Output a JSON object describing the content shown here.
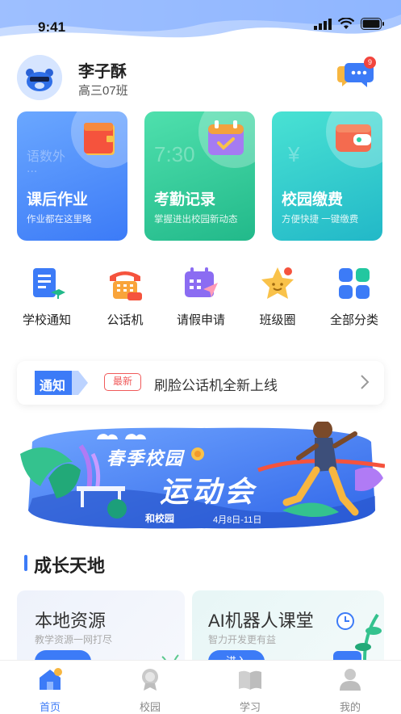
{
  "status": {
    "time": "9:41"
  },
  "user": {
    "name": "李子酥",
    "class": "高三07班",
    "message_count": "9"
  },
  "cards": [
    {
      "title": "课后作业",
      "subtitle": "作业都在这里略",
      "ghost": "语数外",
      "ghost2": "..."
    },
    {
      "title": "考勤记录",
      "subtitle": "掌握进出校园新动态",
      "ghost": "7:30"
    },
    {
      "title": "校园缴费",
      "subtitle": "方便快捷 一键缴费",
      "ghost": "¥"
    }
  ],
  "shortcuts": [
    {
      "label": "学校通知",
      "icon": "notice-doc-icon"
    },
    {
      "label": "公话机",
      "icon": "phone-icon"
    },
    {
      "label": "请假申请",
      "icon": "leave-calendar-icon"
    },
    {
      "label": "班级圈",
      "icon": "star-icon"
    },
    {
      "label": "全部分类",
      "icon": "grid-icon"
    }
  ],
  "notice": {
    "tag": "通知",
    "badge": "最新",
    "text": "刷脸公话机全新上线"
  },
  "banner": {
    "line1": "春季校园",
    "line2": "运动会",
    "brand": "和校园",
    "date": "4月8日-11日"
  },
  "section": {
    "title": "成长天地"
  },
  "resources": [
    {
      "title": "本地资源",
      "subtitle": "教学资源一网打尽",
      "button": ""
    },
    {
      "title": "AI机器人课堂",
      "subtitle": "智力开发更有益",
      "button": "进入"
    }
  ],
  "tabs": [
    {
      "label": "首页",
      "active": true
    },
    {
      "label": "校园",
      "active": false
    },
    {
      "label": "学习",
      "active": false
    },
    {
      "label": "我的",
      "active": false
    }
  ],
  "colors": {
    "primary": "#3c7bf7",
    "green": "#22b98a",
    "teal": "#22b8c8",
    "badge": "#f2453d"
  }
}
